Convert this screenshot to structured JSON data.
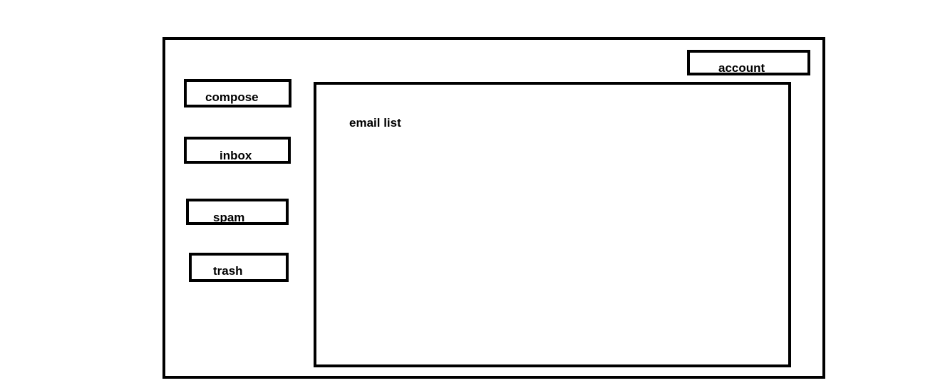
{
  "header": {
    "account_label": "account"
  },
  "sidebar": {
    "items": [
      {
        "id": "compose",
        "label": "compose"
      },
      {
        "id": "inbox",
        "label": "inbox"
      },
      {
        "id": "spam",
        "label": "spam"
      },
      {
        "id": "trash",
        "label": "trash"
      }
    ]
  },
  "main": {
    "email_list_label": "email list"
  },
  "colors": {
    "stroke": "#000000",
    "background": "#ffffff"
  }
}
